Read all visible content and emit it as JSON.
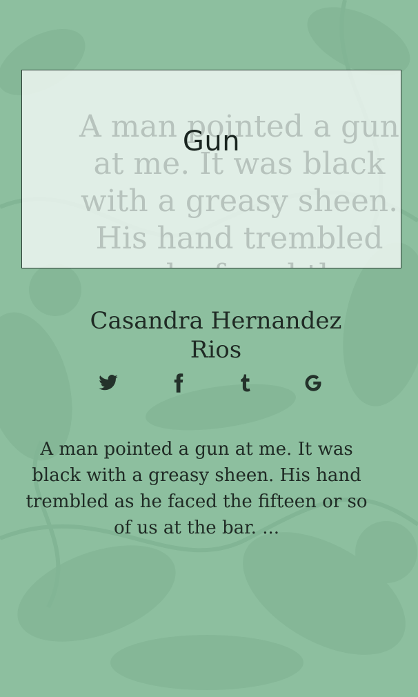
{
  "card": {
    "title": "Gun",
    "watermark_text": "A man pointed a gun at me. It was black with a greasy sheen. His hand trembled as he faced the fifteen"
  },
  "author": {
    "name": "Casandra Hernandez Rios"
  },
  "social": [
    {
      "name": "twitter",
      "icon": "twitter-icon"
    },
    {
      "name": "facebook",
      "icon": "facebook-icon"
    },
    {
      "name": "tumblr",
      "icon": "tumblr-icon"
    },
    {
      "name": "google",
      "icon": "google-icon"
    }
  ],
  "excerpt": {
    "text": "A man pointed a gun at me. It was black with a greasy sheen. His hand trembled as he faced the fifteen or so of us at the bar. ..."
  },
  "colors": {
    "background": "#8dbf9f",
    "card": "#f5faf7",
    "text": "#1f2a24"
  }
}
